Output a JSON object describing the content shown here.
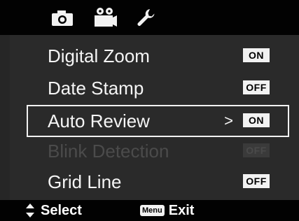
{
  "tabs": [
    {
      "icon": "camera-icon"
    },
    {
      "icon": "movie-camera-icon"
    },
    {
      "icon": "wrench-icon"
    }
  ],
  "menu": {
    "items": [
      {
        "label": "Digital Zoom",
        "value": "ON",
        "state": "normal"
      },
      {
        "label": "Date Stamp",
        "value": "OFF",
        "state": "normal"
      },
      {
        "label": "Auto Review",
        "value": "ON",
        "state": "selected",
        "submenu_arrow": ">"
      },
      {
        "label": "Blink Detection",
        "value": "OFF",
        "state": "disabled"
      },
      {
        "label": "Grid Line",
        "value": "OFF",
        "state": "normal"
      }
    ]
  },
  "hints": {
    "select_label": "Select",
    "menu_key": "Menu",
    "exit_label": "Exit"
  },
  "colors": {
    "background": "#000000",
    "panel": "#2a2a2a",
    "badge": "#f2f2f2",
    "disabled_text": "#4b4b4b"
  }
}
